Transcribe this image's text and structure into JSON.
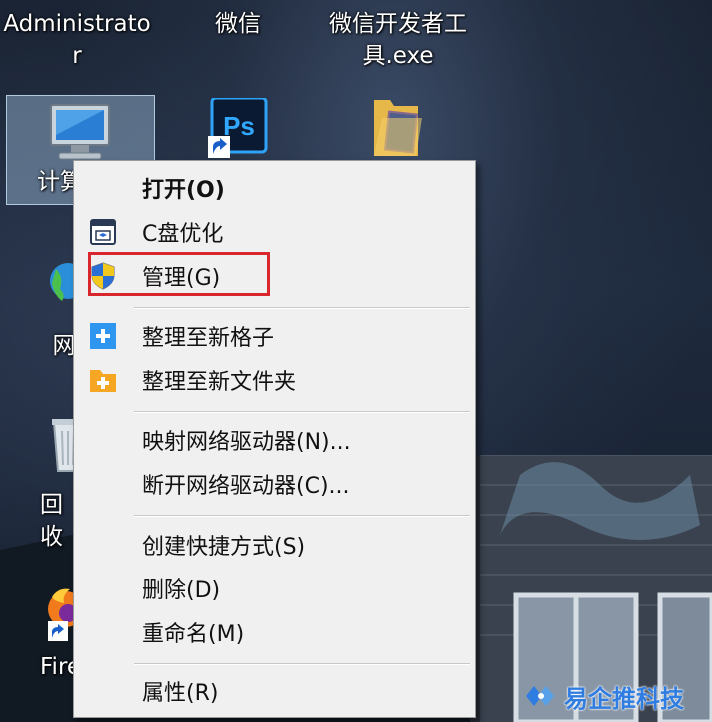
{
  "desktop": {
    "icons": [
      {
        "name": "Administrator",
        "label_line1": "Administrato",
        "label_line2": "r"
      },
      {
        "name": "wechat",
        "label": "微信"
      },
      {
        "name": "wechat-devtools",
        "label_line1": "微信开发者工",
        "label_line2": "具.exe"
      },
      {
        "name": "computer",
        "label_partial": "计算"
      },
      {
        "name": "network",
        "label_partial": "网"
      },
      {
        "name": "recycle-bin",
        "label_partial": "回收"
      },
      {
        "name": "firefox",
        "label_partial": "Fire"
      }
    ]
  },
  "context_menu": {
    "items": [
      {
        "label": "打开(O)",
        "bold": true,
        "icon": null
      },
      {
        "label": "C盘优化",
        "icon": "disk-cleanup-icon"
      },
      {
        "label": "管理(G)",
        "icon": "uac-shield-icon",
        "highlighted": true
      },
      {
        "label": "整理至新格子",
        "icon": "plus-blue-icon"
      },
      {
        "label": "整理至新文件夹",
        "icon": "plus-folder-icon"
      },
      {
        "label": "映射网络驱动器(N)...",
        "icon": null
      },
      {
        "label": "断开网络驱动器(C)...",
        "icon": null
      },
      {
        "label": "创建快捷方式(S)",
        "icon": null
      },
      {
        "label": "删除(D)",
        "icon": null
      },
      {
        "label": "重命名(M)",
        "icon": null
      },
      {
        "label": "属性(R)",
        "icon": null
      }
    ],
    "highlight_color": "#d9262c"
  },
  "watermark": {
    "text": "易企推科技",
    "color": "#2f7de1"
  }
}
